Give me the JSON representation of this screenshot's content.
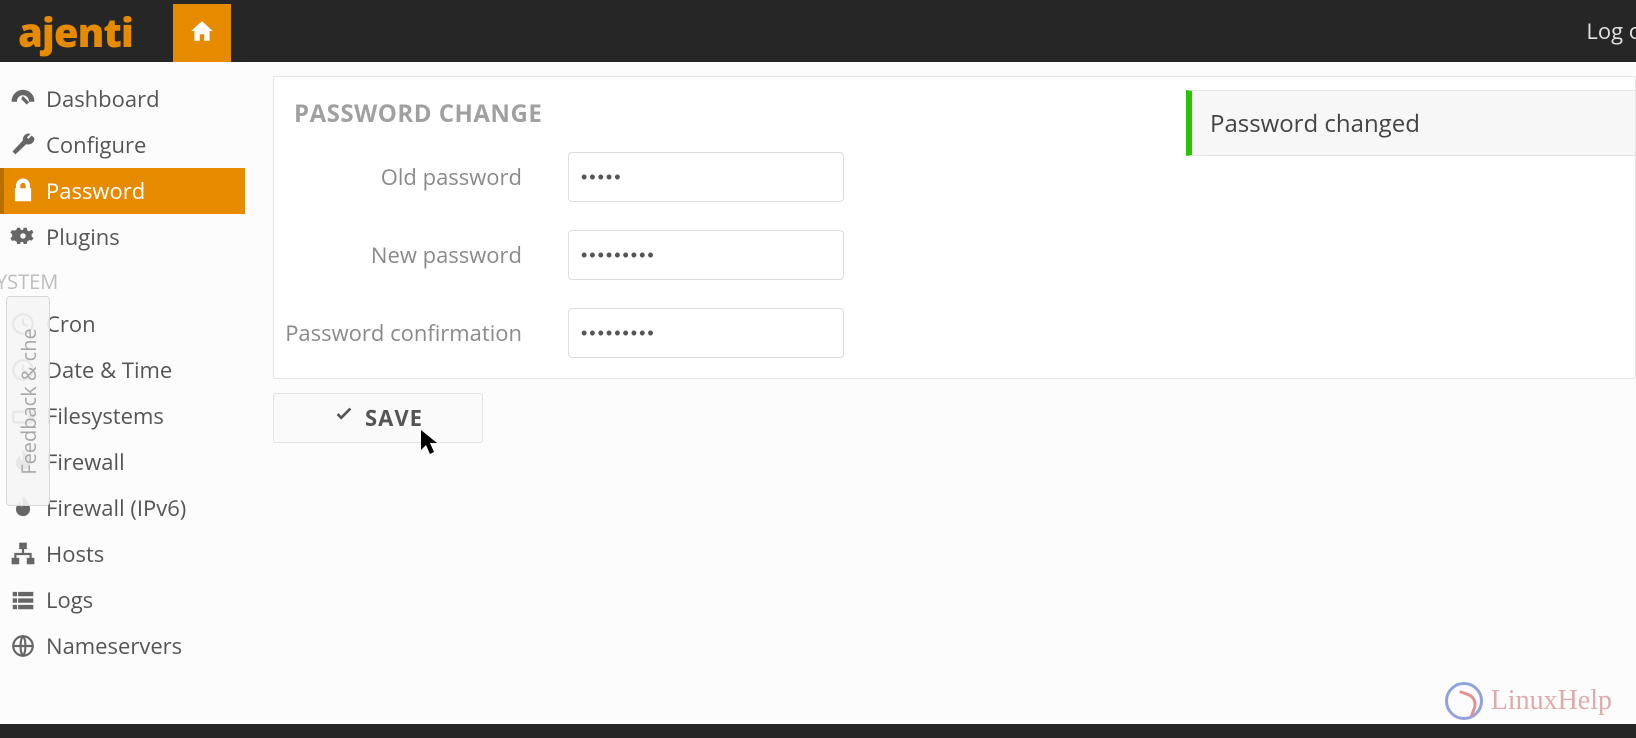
{
  "brand": "ajenti",
  "header": {
    "logout_label": "Log o"
  },
  "sidebar": {
    "items": [
      {
        "label": "Dashboard"
      },
      {
        "label": "Configure"
      },
      {
        "label": "Password"
      },
      {
        "label": "Plugins"
      }
    ],
    "section_label": "YSTEM",
    "system_items": [
      {
        "label": "Cron"
      },
      {
        "label": "Date & Time"
      },
      {
        "label": "Filesystems"
      },
      {
        "label": "Firewall"
      },
      {
        "label": "Firewall (IPv6)"
      },
      {
        "label": "Hosts"
      },
      {
        "label": "Logs"
      },
      {
        "label": "Nameservers"
      }
    ]
  },
  "feedback_tab": "Feedback & che",
  "panel": {
    "title": "PASSWORD CHANGE",
    "old_label": "Old password",
    "old_value": "•••••",
    "new_label": "New password",
    "new_value": "•••••••••",
    "confirm_label": "Password confirmation",
    "confirm_value": "•••••••••",
    "save_label": "SAVE"
  },
  "toast": "Password changed",
  "watermark": "LinuxHelp"
}
